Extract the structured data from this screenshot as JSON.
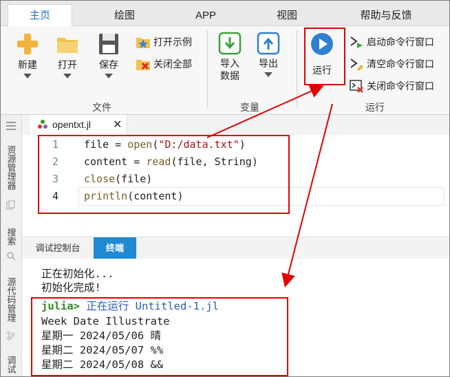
{
  "ribbon_tabs": [
    "主页",
    "绘图",
    "APP",
    "视图",
    "帮助与反馈"
  ],
  "file_group": {
    "new_label": "新建",
    "open_label": "打开",
    "save_label": "保存",
    "open_example_label": "打开示例",
    "close_all_label": "关闭全部",
    "group_label": "文件"
  },
  "variable_group": {
    "import_label_line1": "导入",
    "import_label_line2": "数据",
    "export_label": "导出",
    "group_label": "变量"
  },
  "run_group": {
    "run_label": "运行",
    "start_cmd_label": "启动命令行窗口",
    "clear_cmd_label": "清空命令行窗口",
    "close_cmd_label": "关闭命令行窗口",
    "group_label": "运行"
  },
  "sidebar": {
    "explorer_label": "资源管理器",
    "search_label": "搜索",
    "scm_label": "源代码管理",
    "debug_label": "调试"
  },
  "editor": {
    "file_tab": "opentxt.jl",
    "lines": [
      {
        "num": "1",
        "parts": [
          [
            "",
            "file = "
          ],
          [
            "fn",
            "open"
          ],
          [
            "",
            "("
          ],
          [
            "str",
            "\"D:/data.txt\""
          ],
          [
            "",
            ")"
          ]
        ]
      },
      {
        "num": "2",
        "parts": [
          [
            "",
            "content = "
          ],
          [
            "fn",
            "read"
          ],
          [
            "",
            "(file, String)"
          ]
        ]
      },
      {
        "num": "3",
        "parts": [
          [
            "fn",
            "close"
          ],
          [
            "",
            "(file)"
          ]
        ]
      },
      {
        "num": "4",
        "parts": [
          [
            "fn",
            "println"
          ],
          [
            "",
            "(content)"
          ]
        ]
      }
    ]
  },
  "panel": {
    "tabs": [
      "调试控制台",
      "终端"
    ]
  },
  "terminal": {
    "init_line": "正在初始化...",
    "done_line": "初始化完成!",
    "prompt": "julia>",
    "running_text": "正在运行 Untitled-1.jl",
    "output_lines": [
      "Week Date Illustrate",
      "星期一 2024/05/06 晴",
      "星期二 2024/05/07 %%",
      "星期二 2024/05/08 &&"
    ]
  },
  "colors": {
    "accent": "#1a6fc4",
    "annotation_red": "#e00000",
    "terminal_tab_active": "#1f8ad2"
  }
}
